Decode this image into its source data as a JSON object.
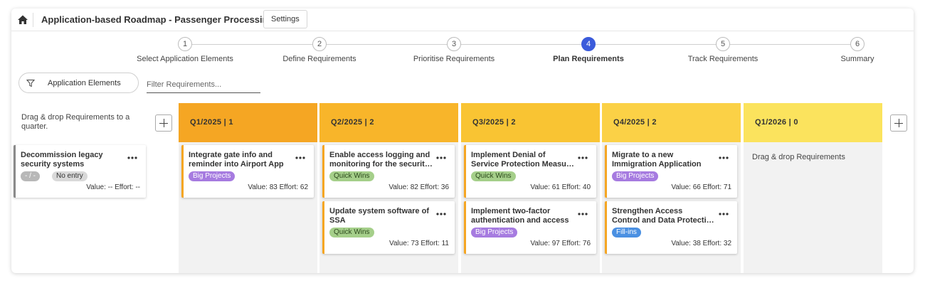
{
  "header": {
    "title": "Application-based Roadmap - Passenger Processing",
    "settings_label": "Settings"
  },
  "steps": [
    {
      "num": "1",
      "label": "Select Application Elements"
    },
    {
      "num": "2",
      "label": "Define Requirements"
    },
    {
      "num": "3",
      "label": "Prioritise Requirements"
    },
    {
      "num": "4",
      "label": "Plan Requirements"
    },
    {
      "num": "5",
      "label": "Track Requirements"
    },
    {
      "num": "6",
      "label": "Summary"
    }
  ],
  "filters": {
    "elements_label": "Application Elements",
    "search_placeholder": "Filter Requirements..."
  },
  "backlog": {
    "hint": "Drag & drop Requirements to a quarter.",
    "card": {
      "title_line1": "Decommission legacy",
      "title_line2": "security systems",
      "tag1": "- / -",
      "tag2": "No entry",
      "meta": "Value: --   Effort: --"
    }
  },
  "columns": [
    {
      "header": "Q1/2025 | 1",
      "color": "#f5a623"
    },
    {
      "header": "Q2/2025 | 2",
      "color": "#f8b52a"
    },
    {
      "header": "Q3/2025 | 2",
      "color": "#f9c433"
    },
    {
      "header": "Q4/2025 | 2",
      "color": "#fbd146"
    },
    {
      "header": "Q1/2026 | 0",
      "color": "#fbe35d",
      "empty_hint": "Drag & drop Requirements"
    }
  ],
  "cards": [
    {
      "title_line1": "Integrate gate info and",
      "title_line2": "reminder into Airport App",
      "tag": "Big Projects",
      "meta": "Value: 83   Effort: 62"
    },
    {
      "title_line1": "Enable access logging and",
      "title_line2": "monitoring for the security systems",
      "tag": "Quick Wins",
      "meta": "Value: 82   Effort: 36"
    },
    {
      "title_line1": "Update system software of",
      "title_line2": "SSA",
      "tag": "Quick Wins",
      "meta": "Value: 73   Effort: 11"
    },
    {
      "title_line1": "Implement Denial of",
      "title_line2": "Service Protection Measures",
      "tag": "Quick Wins",
      "meta": "Value: 61   Effort: 40"
    },
    {
      "title_line1": "Implement two-factor",
      "title_line2": "authentication and access",
      "tag": "Big Projects",
      "meta": "Value: 97   Effort: 76"
    },
    {
      "title_line1": "Migrate to a new",
      "title_line2": "Immigration Application",
      "tag": "Big Projects",
      "meta": "Value: 66   Effort: 71"
    },
    {
      "title_line1": "Strengthen Access",
      "title_line2": "Control and Data Protection",
      "tag": "Fill-ins",
      "meta": "Value: 38   Effort: 32"
    }
  ]
}
